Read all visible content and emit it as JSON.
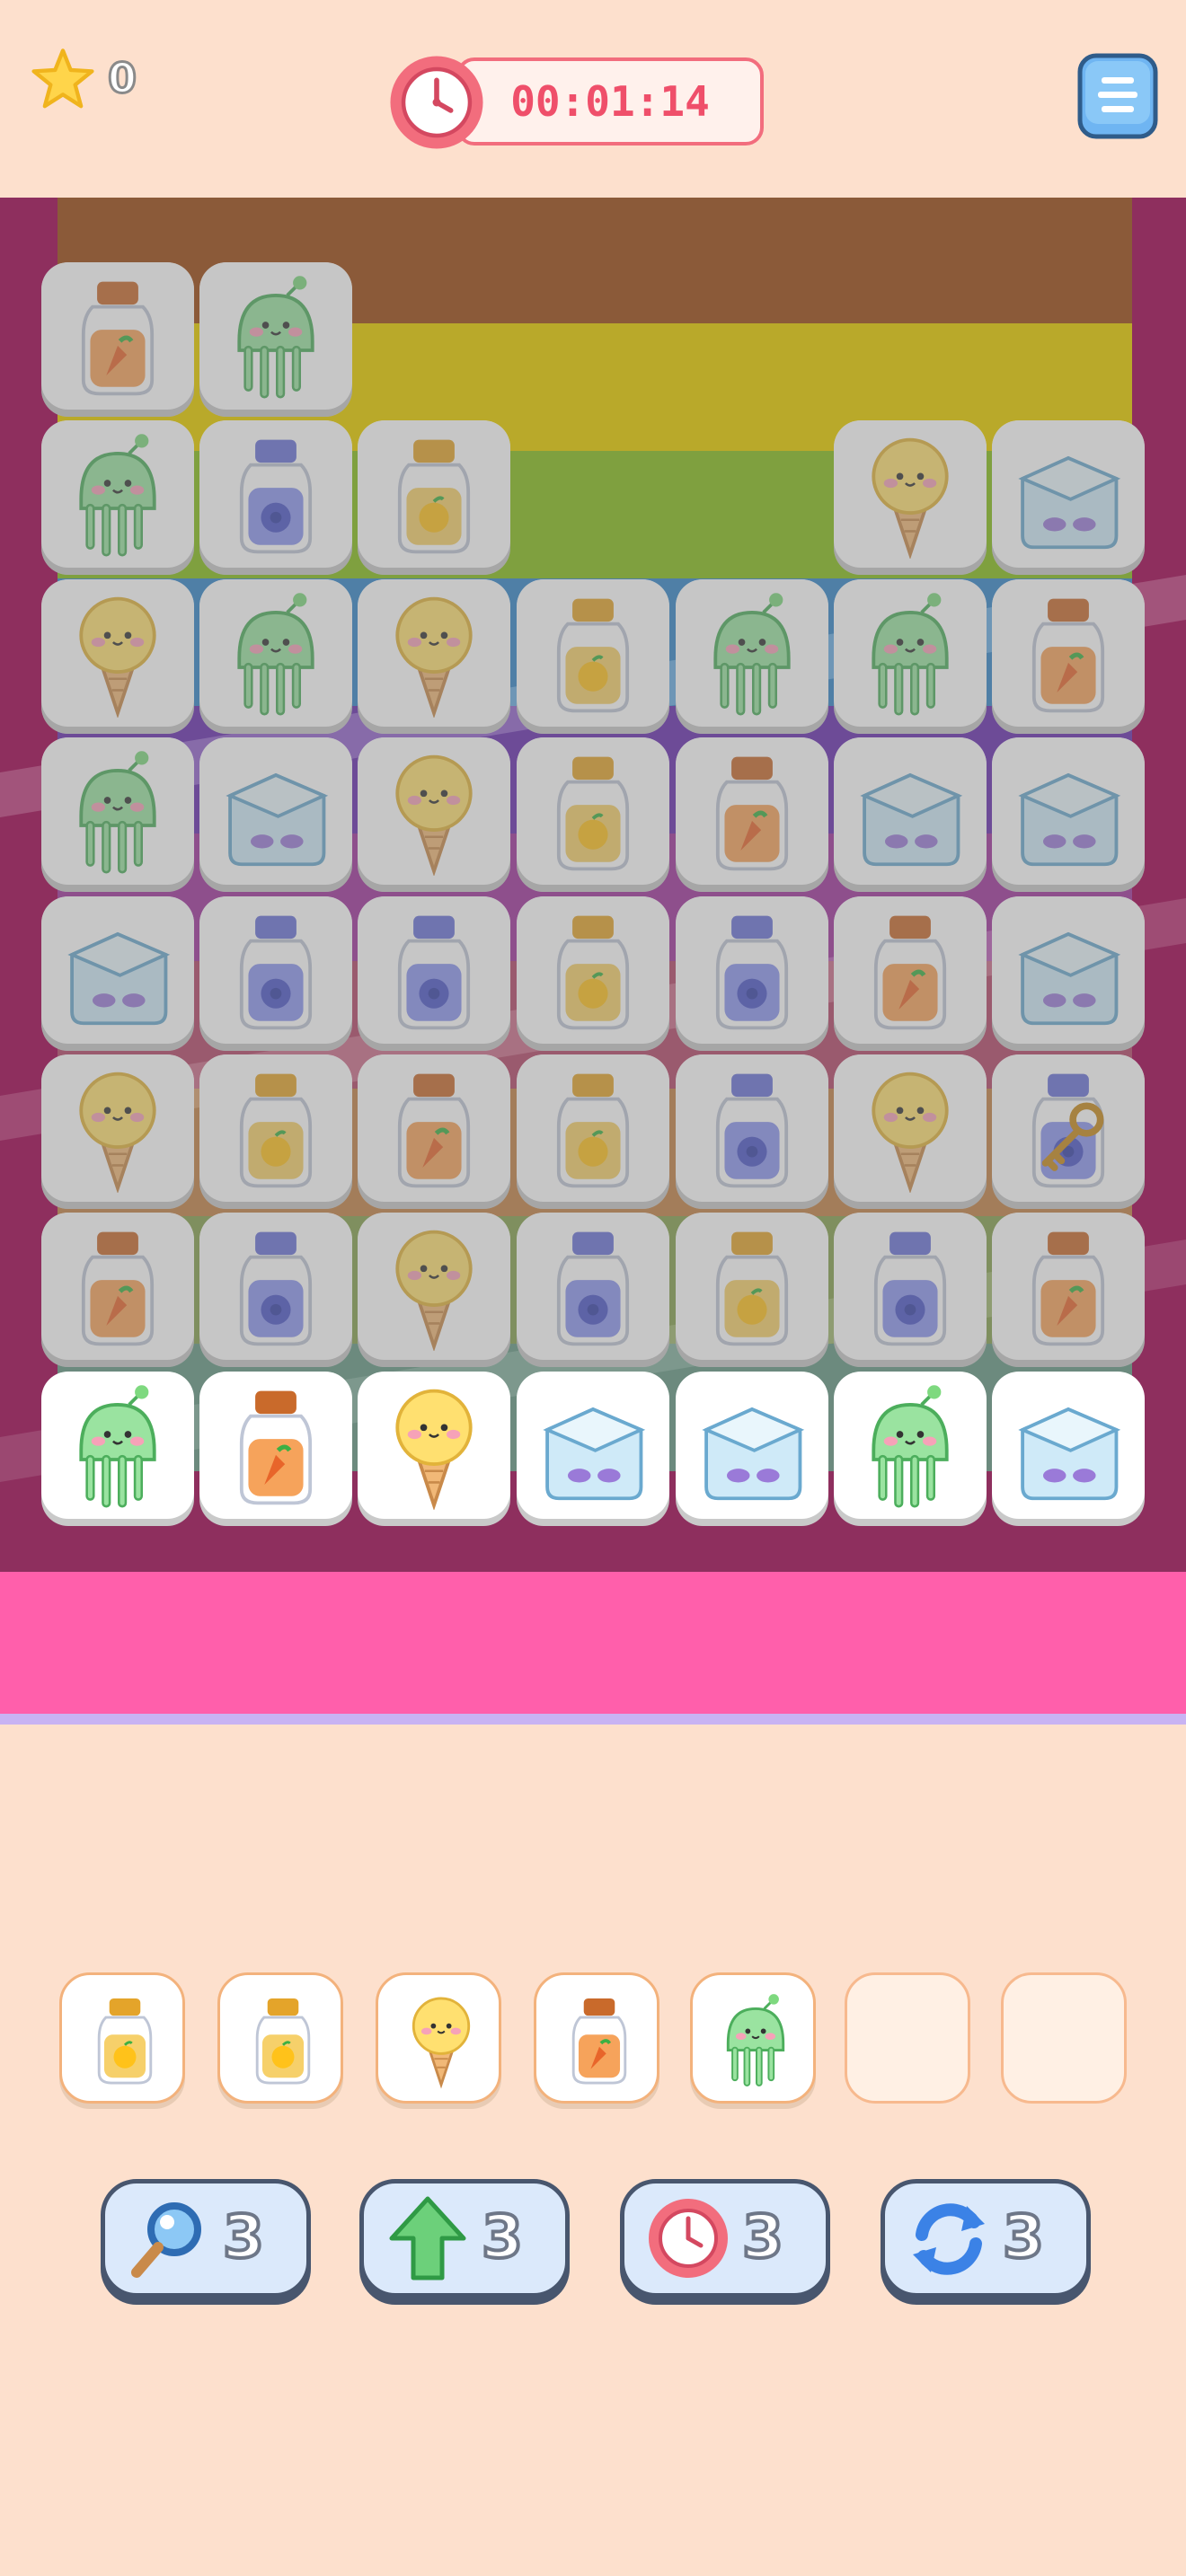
{
  "header": {
    "stars": "0",
    "timer": "00:01:14",
    "star_icon": "star-icon",
    "clock_icon": "clock-icon",
    "menu_icon": "menu-icon"
  },
  "colors": {
    "background": "#fde0cd",
    "timer_text": "#ef4f6a",
    "tile_dim": "rgba(120,120,120,0.42)",
    "booster_bg": "#dbe9fb"
  },
  "board": {
    "rows": [
      [
        "orange-jar",
        "green-jellyfish",
        null,
        null,
        null,
        null,
        null
      ],
      [
        "green-jellyfish",
        "blue-jar",
        "yellow-jar",
        null,
        null,
        "icecream",
        "lunchbox"
      ],
      [
        "icecream",
        "green-jellyfish",
        "icecream",
        "yellow-jar",
        "green-jellyfish",
        "green-jellyfish",
        "orange-jar"
      ],
      [
        "green-jellyfish",
        "lunchbox",
        "icecream",
        "yellow-jar",
        "orange-jar",
        "lunchbox",
        "lunchbox"
      ],
      [
        "lunchbox",
        "blue-jar",
        "blue-jar",
        "yellow-jar",
        "blue-jar",
        "orange-jar",
        "lunchbox"
      ],
      [
        "icecream",
        "yellow-jar",
        "orange-jar",
        "yellow-jar",
        "blue-jar",
        "icecream",
        "blue-jar-key"
      ],
      [
        "orange-jar",
        "blue-jar",
        "icecream",
        "blue-jar",
        "yellow-jar",
        "blue-jar",
        "orange-jar"
      ],
      [
        "green-jellyfish",
        "orange-jar",
        "icecream",
        "lunchbox",
        "lunchbox",
        "green-jellyfish",
        "lunchbox"
      ]
    ],
    "active_row": 7
  },
  "tray": {
    "slots": [
      "yellow-jar",
      "yellow-jar",
      "icecream",
      "orange-jar",
      "green-jellyfish",
      null,
      null
    ]
  },
  "boosters": [
    {
      "icon": "magnifier-icon",
      "count": "3"
    },
    {
      "icon": "arrow-up-icon",
      "count": "3"
    },
    {
      "icon": "clock-icon",
      "count": "3"
    },
    {
      "icon": "shuffle-icon",
      "count": "3"
    }
  ]
}
